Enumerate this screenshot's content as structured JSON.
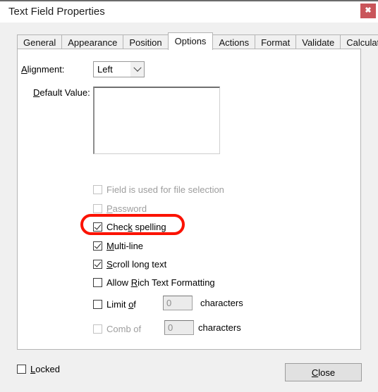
{
  "window": {
    "title": "Text Field Properties",
    "close_icon": "close-icon",
    "close_glyph": "✖"
  },
  "tabs": [
    {
      "label": "General",
      "active": false
    },
    {
      "label": "Appearance",
      "active": false
    },
    {
      "label": "Position",
      "active": false
    },
    {
      "label": "Options",
      "active": true
    },
    {
      "label": "Actions",
      "active": false
    },
    {
      "label": "Format",
      "active": false
    },
    {
      "label": "Validate",
      "active": false
    },
    {
      "label": "Calculate",
      "active": false
    }
  ],
  "options": {
    "alignment": {
      "label_prefix": "",
      "accel": "A",
      "label_suffix": "lignment:",
      "value": "Left",
      "arrow_icon": "chevron-down-icon"
    },
    "default_value": {
      "accel": "D",
      "label_suffix": "efault Value:",
      "value": ""
    },
    "checkboxes": [
      {
        "name": "field-is-used-for-file-selection",
        "pre": "Field is used for file selection",
        "accel": "",
        "post": "",
        "checked": false,
        "disabled": true
      },
      {
        "name": "password",
        "pre": "",
        "accel": "P",
        "post": "assword",
        "checked": false,
        "disabled": true
      },
      {
        "name": "check-spelling",
        "pre": "Chec",
        "accel": "k",
        "post": " spelling",
        "checked": true,
        "disabled": false
      },
      {
        "name": "multi-line",
        "pre": "",
        "accel": "M",
        "post": "ulti-line",
        "checked": true,
        "disabled": false
      },
      {
        "name": "scroll-long-text",
        "pre": "",
        "accel": "S",
        "post": "croll long text",
        "checked": true,
        "disabled": false
      },
      {
        "name": "allow-rich-text-formatting",
        "pre": "Allow ",
        "accel": "R",
        "post": "ich Text Formatting",
        "checked": false,
        "disabled": false
      }
    ],
    "limit_of": {
      "pre": "Limit ",
      "accel": "o",
      "post": "f",
      "checked": false,
      "disabled": false,
      "value": "0",
      "unit": "characters"
    },
    "comb_of": {
      "pre": "Comb of",
      "accel": "",
      "post": "",
      "checked": false,
      "disabled": true,
      "value": "0",
      "unit": "characters"
    },
    "highlight": {
      "target": "check-spelling",
      "color": "#fb1200"
    }
  },
  "footer": {
    "locked": {
      "accel": "L",
      "post": "ocked",
      "checked": false
    },
    "close_button": {
      "accel": "C",
      "post": "lose"
    }
  }
}
